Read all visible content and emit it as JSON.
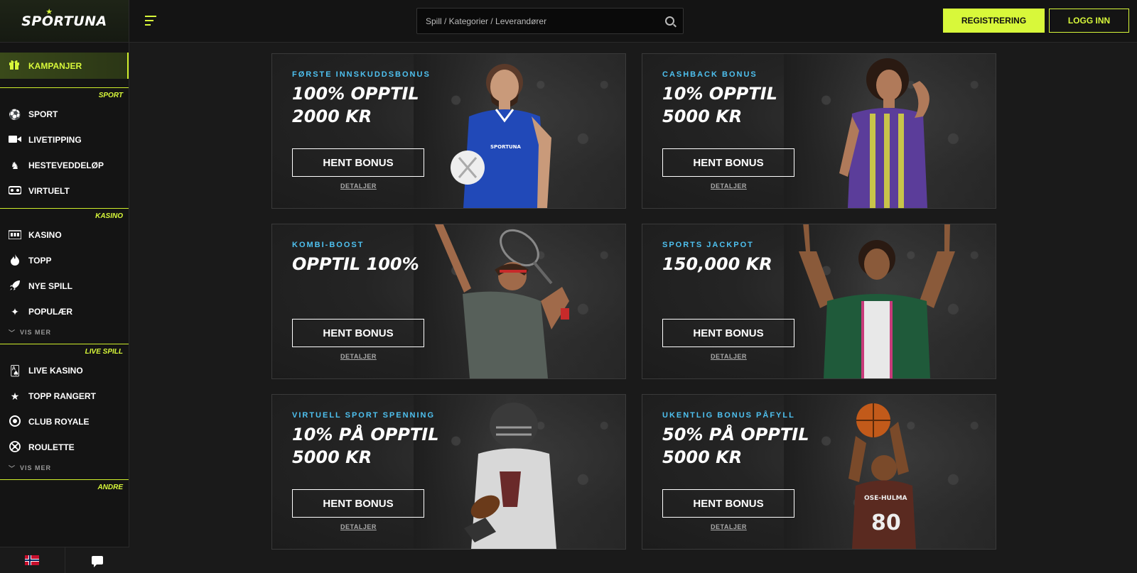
{
  "brand": {
    "name": "SPORTUNA"
  },
  "sidebar": {
    "promo": {
      "label": "KAMPANJER",
      "icon": "gift-icon"
    },
    "sections": [
      {
        "title": "SPORT",
        "items": [
          {
            "label": "SPORT",
            "icon": "soccer-ball-icon"
          },
          {
            "label": "LIVETIPPING",
            "icon": "video-camera-icon"
          },
          {
            "label": "HESTEVEDDELØP",
            "icon": "horse-icon"
          },
          {
            "label": "VIRTUELT",
            "icon": "vr-headset-icon"
          }
        ]
      },
      {
        "title": "KASINO",
        "items": [
          {
            "label": "KASINO",
            "icon": "slot-machine-icon"
          },
          {
            "label": "TOPP",
            "icon": "flame-icon"
          },
          {
            "label": "NYE SPILL",
            "icon": "rocket-icon"
          },
          {
            "label": "POPULÆR",
            "icon": "sparkle-icon"
          }
        ],
        "more": "VIS MER"
      },
      {
        "title": "LIVE SPILL",
        "items": [
          {
            "label": "LIVE KASINO",
            "icon": "cards-icon"
          },
          {
            "label": "TOPP RANGERT",
            "icon": "star-icon"
          },
          {
            "label": "CLUB ROYALE",
            "icon": "chip-icon"
          },
          {
            "label": "ROULETTE",
            "icon": "roulette-icon"
          }
        ],
        "more": "VIS MER"
      },
      {
        "title": "ANDRE",
        "items": []
      }
    ]
  },
  "header": {
    "search_placeholder": "Spill / Kategorier / Leverandører",
    "register_label": "REGISTRERING",
    "login_label": "LOGG INN"
  },
  "promotions": [
    {
      "tag": "FØRSTE INNSKUDDSBONUS",
      "headline": "100% OPPTIL\n2000 KR",
      "cta": "HENT BONUS",
      "details": "DETALJER"
    },
    {
      "tag": "CASHBACK BONUS",
      "headline": "10% OPPTIL\n5000 KR",
      "cta": "HENT BONUS",
      "details": "DETALJER"
    },
    {
      "tag": "KOMBI-BOOST",
      "headline": "OPPTIL 100%",
      "cta": "HENT BONUS",
      "details": "DETALJER"
    },
    {
      "tag": "SPORTS JACKPOT",
      "headline": "150,000 KR",
      "cta": "HENT BONUS",
      "details": "DETALJER"
    },
    {
      "tag": "VIRTUELL SPORT SPENNING",
      "headline": "10% PÅ OPPTIL\n5000 KR",
      "cta": "HENT BONUS",
      "details": "DETALJER"
    },
    {
      "tag": "UKENTLIG BONUS PÅFYLL",
      "headline": "50% PÅ OPPTIL\n5000 KR",
      "cta": "HENT BONUS",
      "details": "DETALJER"
    }
  ],
  "athlete_jerseys": {
    "basketball_name": "OSE-HULMA",
    "basketball_number": "80",
    "football_badge": "SPORTUNA"
  },
  "colors": {
    "accent": "#d8f83a",
    "tag": "#4ec1f0",
    "background": "#1a1a1a"
  }
}
